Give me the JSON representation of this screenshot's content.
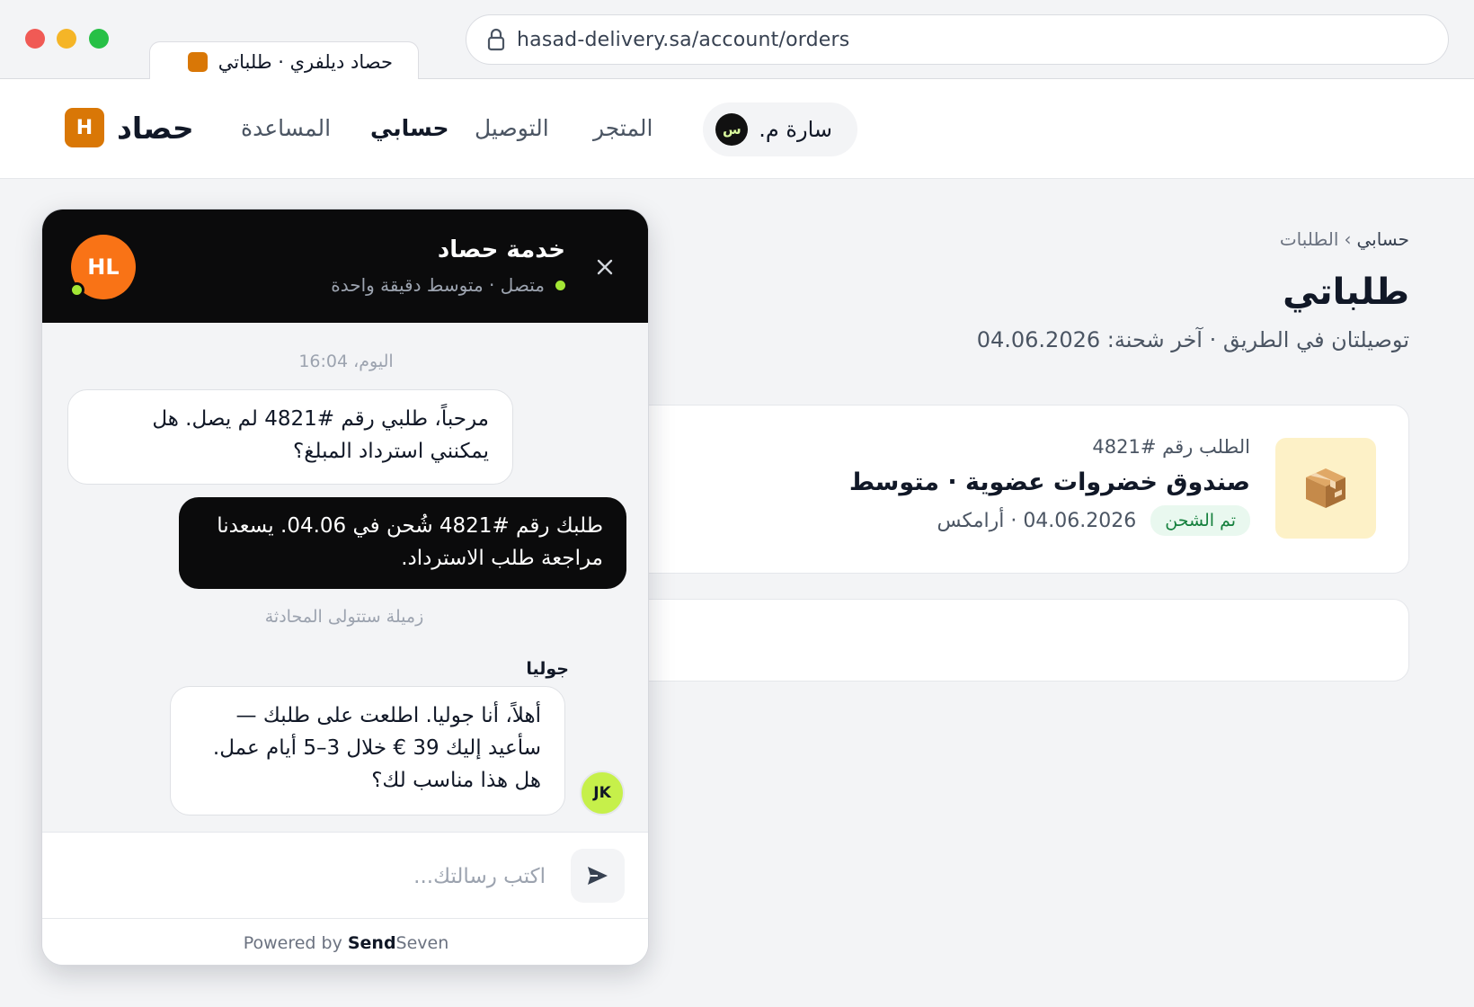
{
  "browser": {
    "tab_title": "حصاد ديلفري · طلباتي",
    "url": "hasad-delivery.sa/account/orders"
  },
  "header": {
    "brand_initial": "H",
    "brand_name": "حصاد",
    "nav": {
      "help": "المساعدة",
      "account": "حسابي",
      "delivery": "التوصيل",
      "store": "المتجر"
    },
    "user": {
      "name": "سارة م.",
      "avatar_letter": "س"
    }
  },
  "main": {
    "breadcrumb": {
      "parent": "حسابي",
      "separator": "›",
      "current": "الطلبات"
    },
    "title": "طلباتي",
    "subtitle": "توصيلتان في الطريق · آخر شحنة: 04.06.2026",
    "orders": [
      {
        "number": "الطلب رقم #4821",
        "name": "صندوق خضروات عضوية · متوسط",
        "status": "تم الشحن",
        "date_carrier": "04.06.2026 · أرامكس",
        "thumb_icon": "package-icon"
      }
    ]
  },
  "chat": {
    "title": "خدمة حصاد",
    "status": "متصل · متوسط دقيقة واحدة",
    "agent_initials": "HL",
    "timestamp": "اليوم، 16:04",
    "messages": [
      {
        "from": "customer",
        "text": "مرحباً، طلبي رقم #4821 لم يصل. هل يمكنني استرداد المبلغ؟"
      },
      {
        "from": "bot",
        "text": "طلبك رقم #4821 شُحن في 04.06. يسعدنا مراجعة طلب الاسترداد."
      },
      {
        "from": "agent",
        "text": "أهلاً، أنا جوليا. اطلعت على طلبك — سأعيد إليك 39 € خلال 3–5 أيام عمل. هل هذا مناسب لك؟"
      }
    ],
    "handover_note": "زميلة ستتولى المحادثة",
    "agent_name": "جوليا",
    "agent_avatar": "JK",
    "input_placeholder": "اكتب رسالتك...",
    "powered_by_prefix": "Powered by",
    "powered_by_brand_bold": "Send",
    "powered_by_brand_rest": "Seven",
    "colors": {
      "header_bg": "#0b0b0c",
      "online": "#a3e635",
      "agent_avatar": "#f97316"
    }
  },
  "icons": [
    "lock-icon",
    "close-icon",
    "send-icon",
    "package-icon",
    "online-status-icon"
  ]
}
